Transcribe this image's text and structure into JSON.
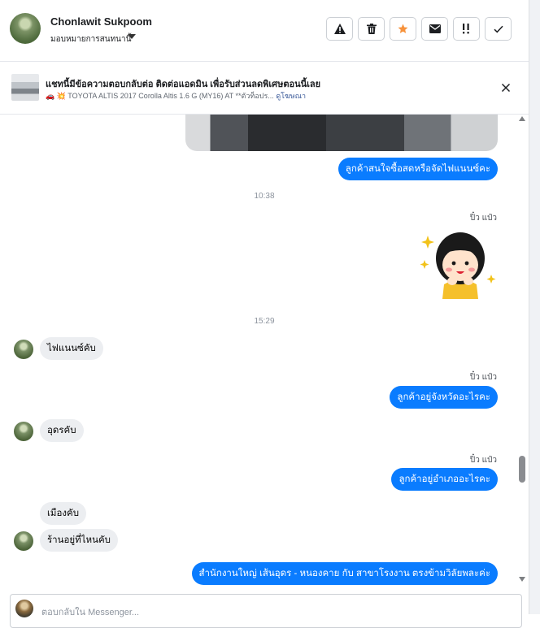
{
  "header": {
    "name": "Chonlawit Sukpoom",
    "assign_label": "มอบหมายการสนทนานี้",
    "tools": [
      "warning-icon",
      "trash-icon",
      "star-icon",
      "envelope-icon",
      "important-icon",
      "check-icon"
    ],
    "star_color": "#f7923b"
  },
  "notice": {
    "title": "แชทนี้มีข้อความตอบกลับต่อ ติดต่อแอดมิน เพื่อรับส่วนลดพิเศษตอนนี้เลย",
    "emoji": "🚗 💥",
    "subtitle": "TOYOTA ALTIS 2017 Corolla Altis 1.6 G (MY16) AT **ตัวท็อปร...",
    "link": "ดูโฆษณา"
  },
  "messages": {
    "m1": "ลูกค้าสนใจซื้อสดหรือจัดไฟแนนซ์คะ",
    "t1": "10:38",
    "s1": "ปิ๋ว แป๋ว",
    "t2": "15:29",
    "m2": "ไฟแนนซ์คับ",
    "s2": "ปิ๋ว แป๋ว",
    "m3": "ลูกค้าอยู่จังหวัดอะไรคะ",
    "m4": "อุดรคับ",
    "s3": "ปิ๋ว แป๋ว",
    "m5": "ลูกค้าอยู่อำเภออะไรคะ",
    "m6": "เมืองคับ",
    "m7": "ร้านอยู่ที่ไหนคับ",
    "m8": "สำนักงานใหญ่ เส้นอุดร - หนองคาย  กับ สาขาโรงงาน ตรงข้ามวิลัยพละค่ะ"
  },
  "reply": {
    "placeholder": "ตอบกลับใน Messenger..."
  },
  "colors": {
    "outgoing": "#0a7cff",
    "incoming": "#eceef1"
  }
}
